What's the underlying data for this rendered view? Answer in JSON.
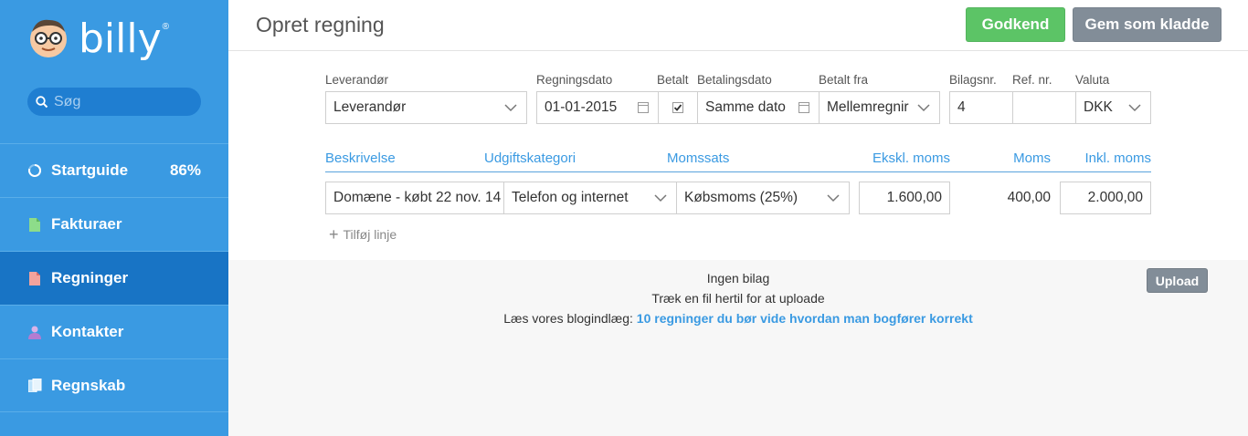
{
  "sidebar": {
    "logo_text": "billy",
    "logo_reg": "®",
    "search_placeholder": "Søg",
    "items": [
      {
        "label": "Startguide",
        "badge": "86%",
        "icon": "progress-ring-icon"
      },
      {
        "label": "Fakturaer",
        "icon": "invoice-doc-icon"
      },
      {
        "label": "Regninger",
        "icon": "bill-doc-icon",
        "active": true
      },
      {
        "label": "Kontakter",
        "icon": "person-icon"
      },
      {
        "label": "Regnskab",
        "icon": "ledger-icon"
      }
    ]
  },
  "header": {
    "title": "Opret regning",
    "approve_label": "Godkend",
    "draft_label": "Gem som kladde"
  },
  "form": {
    "labels": {
      "supplier": "Leverandør",
      "bill_date": "Regningsdato",
      "paid": "Betalt",
      "payment_date": "Betalingsdato",
      "paid_from": "Betalt fra",
      "voucher_no": "Bilagsnr.",
      "ref_no": "Ref. nr.",
      "currency": "Valuta"
    },
    "values": {
      "supplier": "Leverandør",
      "bill_date": "01-01-2015",
      "paid_checked": true,
      "payment_date": "Samme dato",
      "paid_from": "Mellemregnir",
      "voucher_no": "4",
      "ref_no": "",
      "currency": "DKK"
    }
  },
  "lines": {
    "headers": {
      "description": "Beskrivelse",
      "category": "Udgiftskategori",
      "vat_rate": "Momssats",
      "excl_vat": "Ekskl. moms",
      "vat": "Moms",
      "incl_vat": "Inkl. moms"
    },
    "rows": [
      {
        "description": "Domæne - købt 22 nov. 14",
        "category": "Telefon og internet",
        "vat_rate": "Købsmoms (25%)",
        "excl_vat": "1.600,00",
        "vat": "400,00",
        "incl_vat": "2.000,00"
      }
    ],
    "add_line_label": "Tilføj linje"
  },
  "upload": {
    "no_attachment": "Ingen bilag",
    "drag_text": "Træk en fil hertil for at uploade",
    "blog_prefix": "Læs vores blogindlæg:",
    "blog_link": "10 regninger du bør vide hvordan man bogfører korrekt",
    "upload_label": "Upload"
  },
  "colors": {
    "sidebar_bg": "#3a9ae2",
    "sidebar_active": "#1874c5",
    "accent": "#3a9ae2",
    "approve": "#5cc466",
    "neutral_button": "#828d98"
  }
}
